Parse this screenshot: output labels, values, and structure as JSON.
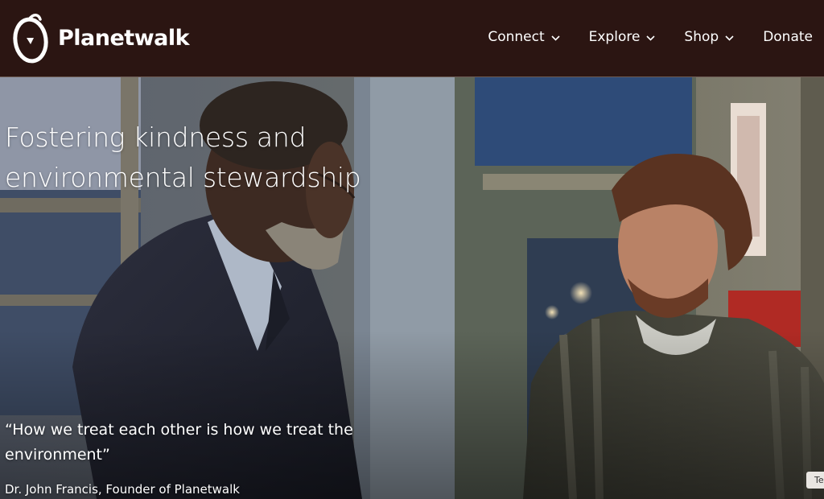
{
  "brand": {
    "name": "Planetwalk",
    "logo_icon": "planetwalk-logo-icon"
  },
  "nav": {
    "items": [
      {
        "label": "Connect",
        "has_dropdown": true
      },
      {
        "label": "Explore",
        "has_dropdown": true
      },
      {
        "label": "Shop",
        "has_dropdown": true
      },
      {
        "label": "Donate",
        "has_dropdown": false
      }
    ]
  },
  "hero": {
    "headline_line1": "Fostering kindness and",
    "headline_line2": "environmental stewardship",
    "quote_line1": "“How we treat each other is how we treat the",
    "quote_line2": "environment”",
    "attribution": "Dr. John  Francis,  Founder of  Planetwalk"
  },
  "edge_tab": {
    "label": "Te"
  },
  "colors": {
    "header_bg": "#2b1512",
    "text": "#ffffff"
  }
}
